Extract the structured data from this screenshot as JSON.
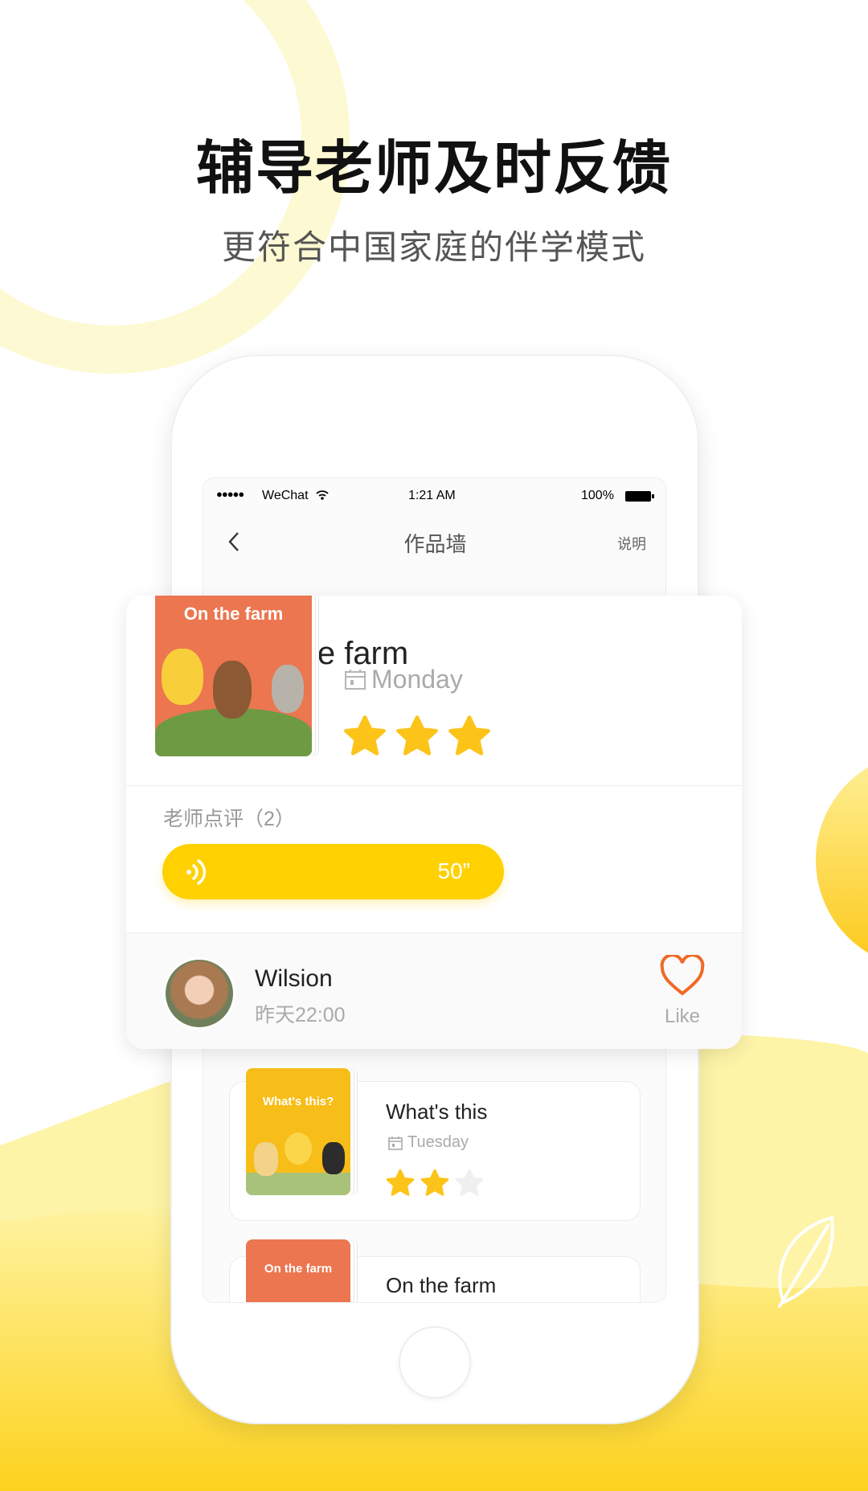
{
  "headline": "辅导老师及时反馈",
  "subheadline": "更符合中国家庭的伴学模式",
  "colors": {
    "accent": "#ffd100",
    "orange": "#f06a27",
    "cover_orange": "#ec7650",
    "cover_yellow": "#f7bd18",
    "pale_yellow": "#fdf9d2"
  },
  "status_bar": {
    "carrier": "WeChat",
    "time": "1:21 AM",
    "battery": "100%"
  },
  "nav": {
    "title": "作品墙",
    "right": "说明",
    "back_icon": "chevron-left-icon"
  },
  "featured": {
    "cover_text": "On the farm",
    "title": "On the farm",
    "day": "Monday",
    "rating": 3,
    "max_rating": 3,
    "comments_label": "老师点评（2）",
    "voice_duration": "50”",
    "user": {
      "name": "Wilsion",
      "time": "昨天22:00"
    },
    "like_label": "Like"
  },
  "list": [
    {
      "cover_text": "What's this?",
      "title": "What's this",
      "day": "Tuesday",
      "rating": 2,
      "max_rating": 3
    },
    {
      "cover_text": "On the farm",
      "title": "On the farm"
    }
  ]
}
